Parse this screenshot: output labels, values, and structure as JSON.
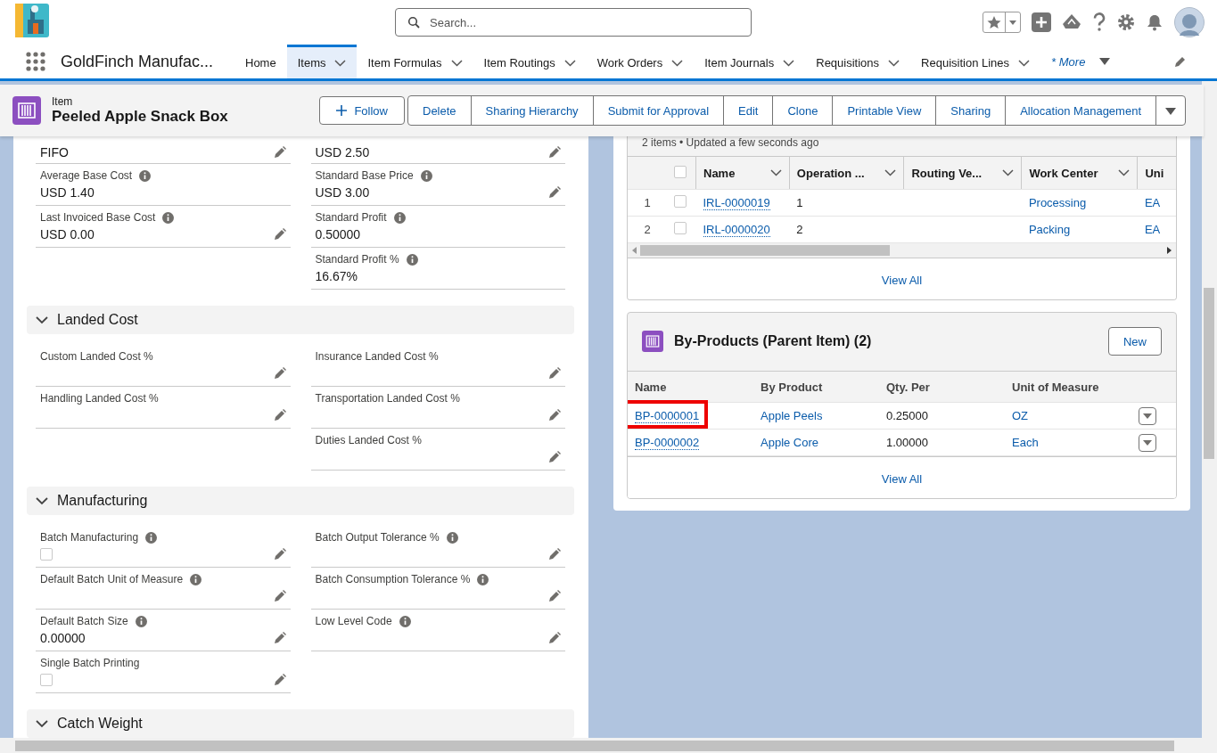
{
  "header": {
    "search": {
      "placeholder": "Search..."
    }
  },
  "nav": {
    "app_name": "GoldFinch Manufac...",
    "more": "* More",
    "tabs": [
      {
        "label": "Home",
        "selected": false,
        "dropdown": false
      },
      {
        "label": "Items",
        "selected": true,
        "dropdown": true
      },
      {
        "label": "Item Formulas",
        "selected": false,
        "dropdown": true
      },
      {
        "label": "Item Routings",
        "selected": false,
        "dropdown": true
      },
      {
        "label": "Work Orders",
        "selected": false,
        "dropdown": true
      },
      {
        "label": "Item Journals",
        "selected": false,
        "dropdown": true
      },
      {
        "label": "Requisitions",
        "selected": false,
        "dropdown": true
      },
      {
        "label": "Requisition Lines",
        "selected": false,
        "dropdown": true
      }
    ]
  },
  "record": {
    "object": "Item",
    "title": "Peeled Apple Snack Box",
    "follow": "Follow",
    "actions": [
      "Delete",
      "Sharing Hierarchy",
      "Submit for Approval",
      "Edit",
      "Clone",
      "Printable View",
      "Sharing",
      "Allocation Management"
    ]
  },
  "details": {
    "sections": [
      {
        "left": [
          {
            "kind": "text",
            "value": "FIFO",
            "editable": true
          },
          {
            "kind": "text",
            "label": "Average Base Cost",
            "info": true,
            "value": "USD 1.40",
            "editable": false
          },
          {
            "kind": "text",
            "label": "Last Invoiced Base Cost",
            "info": true,
            "value": "USD 0.00",
            "editable": true
          }
        ],
        "right": [
          {
            "kind": "text",
            "value": "USD 2.50",
            "editable": true
          },
          {
            "kind": "text",
            "label": "Standard Base Price",
            "info": true,
            "value": "USD 3.00",
            "editable": true
          },
          {
            "kind": "text",
            "label": "Standard Profit",
            "info": true,
            "value": "0.50000",
            "editable": false
          },
          {
            "kind": "text",
            "label": "Standard Profit %",
            "info": true,
            "value": "16.67%",
            "editable": false
          }
        ]
      },
      {
        "title": "Landed Cost",
        "expanded": true,
        "left": [
          {
            "kind": "text",
            "label": "Custom Landed Cost %",
            "info": false,
            "editable": true
          },
          {
            "kind": "text",
            "label": "Handling Landed Cost %",
            "info": false,
            "editable": true
          }
        ],
        "right": [
          {
            "kind": "text",
            "label": "Insurance Landed Cost %",
            "info": false,
            "editable": true
          },
          {
            "kind": "text",
            "label": "Transportation Landed Cost %",
            "info": false,
            "editable": true
          },
          {
            "kind": "text",
            "label": "Duties Landed Cost %",
            "info": false,
            "editable": true
          }
        ]
      },
      {
        "title": "Manufacturing",
        "expanded": true,
        "left": [
          {
            "kind": "checkbox",
            "label": "Batch Manufacturing",
            "info": true,
            "checked": false,
            "editable": true
          },
          {
            "kind": "text",
            "label": "Default Batch Unit of Measure",
            "info": true,
            "editable": true
          },
          {
            "kind": "text",
            "label": "Default Batch Size",
            "info": true,
            "value": "0.00000",
            "editable": true
          },
          {
            "kind": "checkbox",
            "label": "Single Batch Printing",
            "info": false,
            "checked": false,
            "editable": true
          }
        ],
        "right": [
          {
            "kind": "text",
            "label": "Batch Output Tolerance %",
            "info": true,
            "editable": true
          },
          {
            "kind": "text",
            "label": "Batch Consumption Tolerance %",
            "info": true,
            "editable": true
          },
          {
            "kind": "text",
            "label": "Low Level Code",
            "info": true,
            "editable": true
          }
        ]
      },
      {
        "title": "Catch Weight",
        "expanded": true
      }
    ]
  },
  "routing_lines": {
    "summary": "2 items • Updated a few seconds ago",
    "all_selected": false,
    "columns": [
      {
        "label": "Name",
        "menu": true
      },
      {
        "label": "Operation ...",
        "menu": true
      },
      {
        "label": "Routing Ve...",
        "menu": true
      },
      {
        "label": "Work Center",
        "menu": true
      },
      {
        "label": "Uni",
        "menu": false
      }
    ],
    "rows": [
      {
        "number": "1",
        "selected": false,
        "name": "IRL-0000019",
        "operation": "1",
        "work_center": "Processing",
        "unit": "EA"
      },
      {
        "number": "2",
        "selected": false,
        "name": "IRL-0000020",
        "operation": "2",
        "work_center": "Packing",
        "unit": "EA"
      }
    ],
    "view_all": "View All"
  },
  "by_products": {
    "title": "By-Products (Parent Item) (2)",
    "new": "New",
    "columns": [
      "Name",
      "By Product",
      "Qty. Per",
      "Unit of Measure"
    ],
    "rows": [
      {
        "name": "BP-0000001",
        "by_product": "Apple Peels",
        "qty_per": "0.25000",
        "unit": "OZ",
        "highlighted": true
      },
      {
        "name": "BP-0000002",
        "by_product": "Apple Core",
        "qty_per": "1.00000",
        "unit": "Each",
        "highlighted": false
      }
    ],
    "view_all": "View All"
  }
}
